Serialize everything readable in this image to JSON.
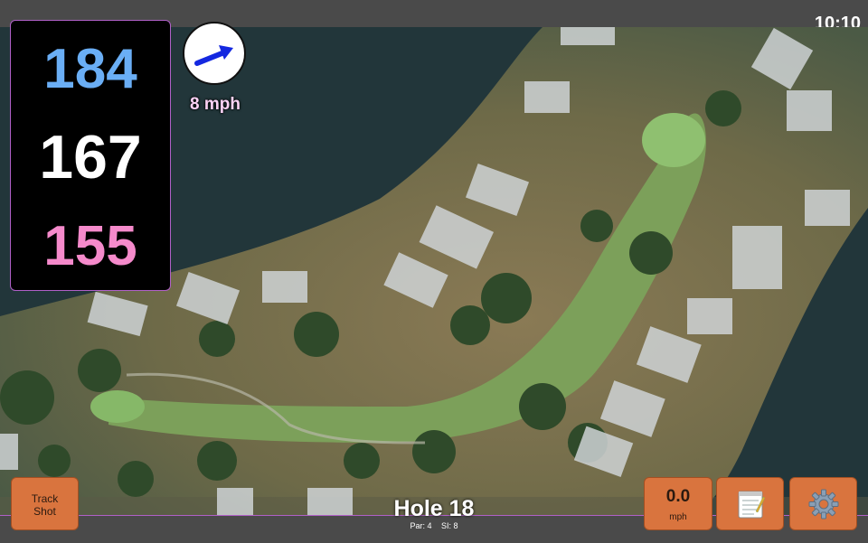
{
  "status": {
    "clock": "10:10"
  },
  "distances": {
    "back": "184",
    "middle": "167",
    "front": "155"
  },
  "wind": {
    "speed_label": "8 mph",
    "direction_icon": "wind-arrow-icon"
  },
  "hole": {
    "title": "Hole 18",
    "par_label": "Par: 4",
    "si_label": "SI: 8"
  },
  "buttons": {
    "track_shot": {
      "line1": "Track",
      "line2": "Shot"
    },
    "speed": {
      "value": "0.0",
      "unit": "mph"
    },
    "notes_icon": "notepad-icon",
    "settings_icon": "gear-icon"
  },
  "colors": {
    "back_distance": "#6aaef5",
    "middle_distance": "#ffffff",
    "front_distance": "#f58acb",
    "button_fill": "#d9743e",
    "accent_border": "#b060c8"
  }
}
